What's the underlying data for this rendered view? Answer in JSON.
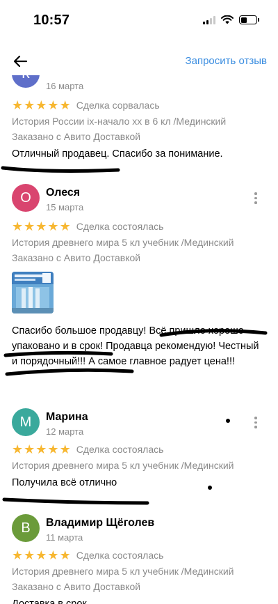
{
  "status_bar": {
    "time": "10:57"
  },
  "nav": {
    "request_review_label": "Запросить отзыв"
  },
  "reviews": [
    {
      "author": "",
      "initial": "К",
      "avatar_color": "#5f6fc9",
      "date": "16 марта",
      "stars": 5,
      "deal_status": "Сделка сорвалась",
      "item_lines": [
        "История России ix-начало xx в 6 кл /Мединский",
        "Заказано с Авито Доставкой"
      ],
      "text": "Отличный продавец. Спасибо за понимание."
    },
    {
      "author": "Олеся",
      "initial": "О",
      "avatar_color": "#d9456f",
      "date": "15 марта",
      "stars": 5,
      "deal_status": "Сделка состоялась",
      "item_lines": [
        "История древнего мира 5 кл учебник /Мединский",
        "Заказано с Авито Доставкой"
      ],
      "text": "Спасибо большое продавцу! Всё пришло хорошо упаковано и в срок! Продавца рекомендую! Честный и порядочный!!! А самое главное радует цена!!!"
    },
    {
      "author": "Марина",
      "initial": "М",
      "avatar_color": "#3aa99c",
      "date": "12 марта",
      "stars": 5,
      "deal_status": "Сделка состоялась",
      "item_lines": [
        "История древнего мира 5 кл учебник /Мединский"
      ],
      "text": "Получила всё отлично"
    },
    {
      "author": "Владимир Щёголев",
      "initial": "В",
      "avatar_color": "#6b9b3a",
      "date": "11 марта",
      "stars": 5,
      "deal_status": "Сделка состоялась",
      "item_lines": [
        "История древнего мира 5 кл учебник /Мединский",
        "Заказано с Авито Доставкой"
      ],
      "text": "Доставка в срок"
    }
  ],
  "colors": {
    "accent": "#3a8de0",
    "star": "#f7b731",
    "muted": "#8a8a8a"
  },
  "icons": {
    "back": "arrow-left-icon",
    "more": "more-vertical-icon",
    "star": "star-icon"
  }
}
